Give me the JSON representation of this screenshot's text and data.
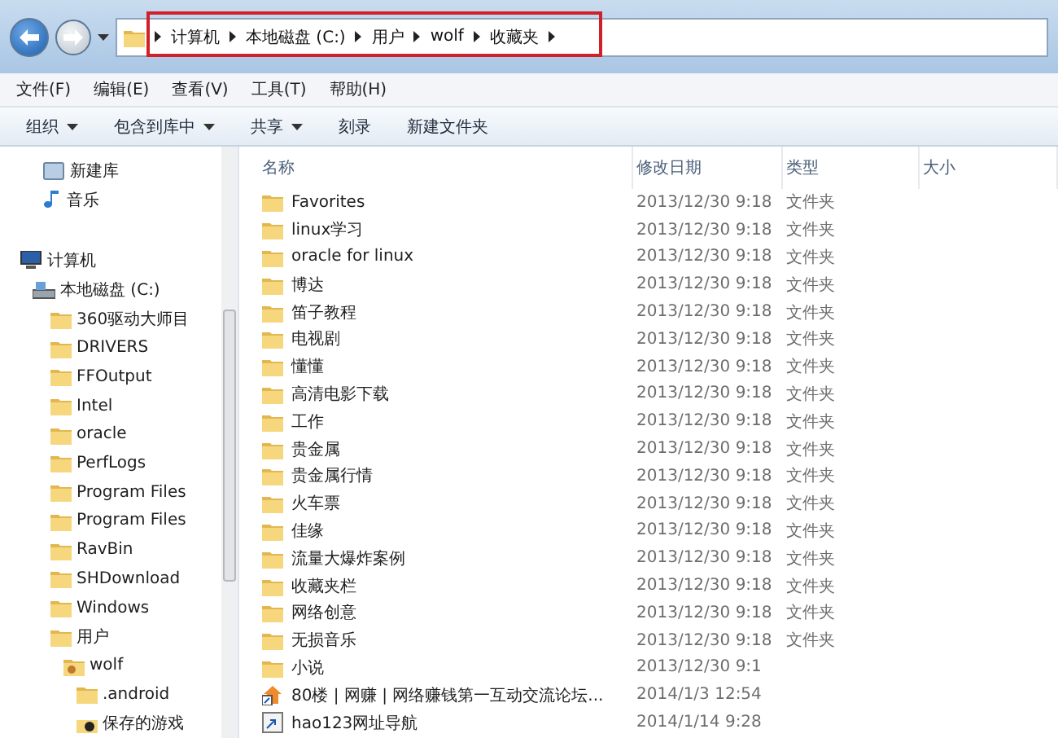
{
  "address_bar": {
    "crumbs": [
      "计算机",
      "本地磁盘 (C:)",
      "用户",
      "wolf",
      "收藏夹"
    ]
  },
  "menu_bar": [
    "文件(F)",
    "编辑(E)",
    "查看(V)",
    "工具(T)",
    "帮助(H)"
  ],
  "toolbar": [
    {
      "label": "组织",
      "dropdown": true
    },
    {
      "label": "包含到库中",
      "dropdown": true
    },
    {
      "label": "共享",
      "dropdown": true
    },
    {
      "label": "刻录",
      "dropdown": false
    },
    {
      "label": "新建文件夹",
      "dropdown": false
    }
  ],
  "sidebar": {
    "libraries": [
      {
        "label": "新建库",
        "kind": "library"
      },
      {
        "label": "音乐",
        "kind": "music"
      }
    ],
    "tree": [
      {
        "label": "计算机",
        "kind": "computer",
        "children": [
          {
            "label": "本地磁盘 (C:)",
            "kind": "drive",
            "children": [
              {
                "label": "360驱动大师目",
                "kind": "folder"
              },
              {
                "label": "DRIVERS",
                "kind": "folder"
              },
              {
                "label": "FFOutput",
                "kind": "folder"
              },
              {
                "label": "Intel",
                "kind": "folder"
              },
              {
                "label": "oracle",
                "kind": "folder"
              },
              {
                "label": "PerfLogs",
                "kind": "folder"
              },
              {
                "label": "Program Files",
                "kind": "folder"
              },
              {
                "label": "Program Files",
                "kind": "folder"
              },
              {
                "label": "RavBin",
                "kind": "folder"
              },
              {
                "label": "SHDownload",
                "kind": "folder"
              },
              {
                "label": "Windows",
                "kind": "folder"
              },
              {
                "label": "用户",
                "kind": "folder",
                "children": [
                  {
                    "label": "wolf",
                    "kind": "user",
                    "children": [
                      {
                        "label": ".android",
                        "kind": "folder"
                      },
                      {
                        "label": "保存的游戏",
                        "kind": "game"
                      }
                    ]
                  }
                ]
              }
            ]
          }
        ]
      }
    ]
  },
  "table": {
    "columns": [
      "名称",
      "修改日期",
      "类型",
      "大小"
    ],
    "rows": [
      {
        "name": "Favorites",
        "date": "2013/12/30 9:18",
        "type": "文件夹",
        "kind": "folder"
      },
      {
        "name": "linux学习",
        "date": "2013/12/30 9:18",
        "type": "文件夹",
        "kind": "folder"
      },
      {
        "name": "oracle for linux",
        "date": "2013/12/30 9:18",
        "type": "文件夹",
        "kind": "folder"
      },
      {
        "name": "博达",
        "date": "2013/12/30 9:18",
        "type": "文件夹",
        "kind": "folder"
      },
      {
        "name": "笛子教程",
        "date": "2013/12/30 9:18",
        "type": "文件夹",
        "kind": "folder"
      },
      {
        "name": "电视剧",
        "date": "2013/12/30 9:18",
        "type": "文件夹",
        "kind": "folder"
      },
      {
        "name": "懂懂",
        "date": "2013/12/30 9:18",
        "type": "文件夹",
        "kind": "folder"
      },
      {
        "name": "高清电影下载",
        "date": "2013/12/30 9:18",
        "type": "文件夹",
        "kind": "folder"
      },
      {
        "name": "工作",
        "date": "2013/12/30 9:18",
        "type": "文件夹",
        "kind": "folder"
      },
      {
        "name": "贵金属",
        "date": "2013/12/30 9:18",
        "type": "文件夹",
        "kind": "folder"
      },
      {
        "name": "贵金属行情",
        "date": "2013/12/30 9:18",
        "type": "文件夹",
        "kind": "folder"
      },
      {
        "name": "火车票",
        "date": "2013/12/30 9:18",
        "type": "文件夹",
        "kind": "folder"
      },
      {
        "name": "佳缘",
        "date": "2013/12/30 9:18",
        "type": "文件夹",
        "kind": "folder"
      },
      {
        "name": "流量大爆炸案例",
        "date": "2013/12/30 9:18",
        "type": "文件夹",
        "kind": "folder"
      },
      {
        "name": "收藏夹栏",
        "date": "2013/12/30 9:18",
        "type": "文件夹",
        "kind": "folder"
      },
      {
        "name": "网络创意",
        "date": "2013/12/30 9:18",
        "type": "文件夹",
        "kind": "folder"
      },
      {
        "name": "无损音乐",
        "date": "2013/12/30 9:18",
        "type": "文件夹",
        "kind": "folder"
      },
      {
        "name": "小说",
        "date": "2013/12/30 9:1",
        "kind": "folder"
      },
      {
        "name": "80楼 | 网赚 | 网络赚钱第一互动交流论坛...",
        "date": "2014/1/3 12:54",
        "kind": "web-shortcut"
      },
      {
        "name": "hao123网址导航",
        "date": "2014/1/14 9:28",
        "kind": "shortcut"
      }
    ]
  }
}
